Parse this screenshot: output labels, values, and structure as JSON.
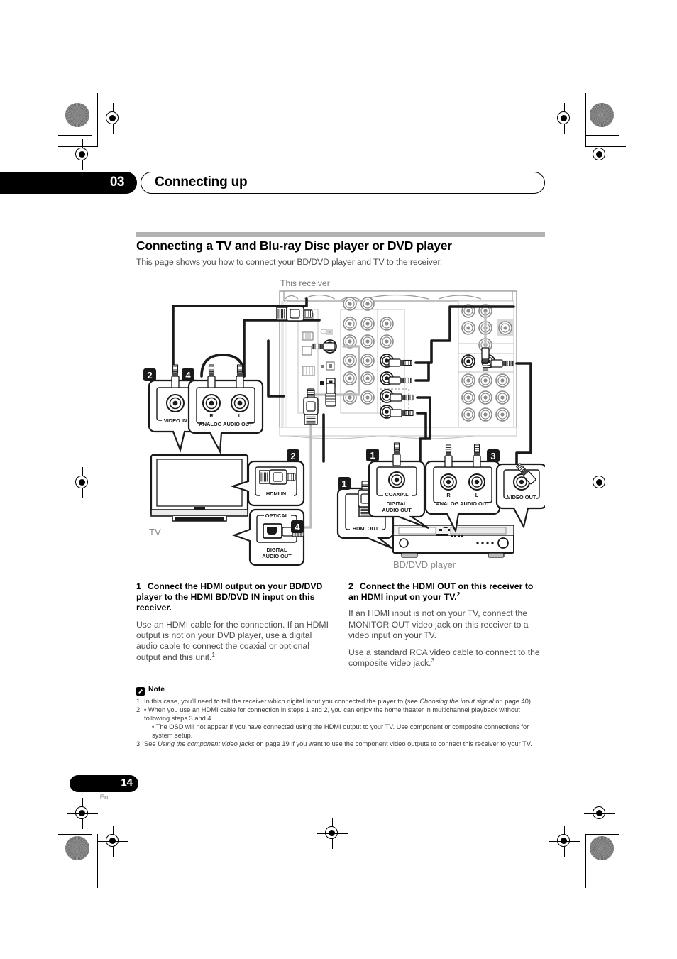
{
  "header": {
    "chapter_number": "03",
    "chapter_title": "Connecting up"
  },
  "section": {
    "title": "Connecting a TV and Blu-ray Disc player or DVD player",
    "subtitle": "This page shows you how to connect your BD/DVD player and TV to the receiver."
  },
  "diagram": {
    "receiver_caption": "This receiver",
    "tv_caption": "TV",
    "player_caption": "BD/DVD player",
    "callouts": {
      "one": "1",
      "two": "2",
      "three": "3",
      "four": "4"
    },
    "ports": {
      "tv_video_in": "VIDEO IN",
      "tv_analog_audio_out": "ANALOG AUDIO OUT",
      "tv_analog_r": "R",
      "tv_analog_l": "L",
      "tv_hdmi_in": "HDMI IN",
      "tv_optical": "OPTICAL",
      "tv_digital_audio_out_line1": "DIGITAL",
      "tv_digital_audio_out_line2": "AUDIO OUT",
      "player_hdmi_out": "HDMI OUT",
      "player_coaxial": "COAXIAL",
      "player_digital_audio_out_line1": "DIGITAL",
      "player_digital_audio_out_line2": "AUDIO OUT",
      "player_analog_audio_out": "ANALOG AUDIO OUT",
      "player_analog_r": "R",
      "player_analog_l": "L",
      "player_video_out": "VIDEO OUT"
    }
  },
  "steps": [
    {
      "number": "1",
      "heading": "Connect the HDMI output on your BD/DVD player to the HDMI BD/DVD IN input on this receiver.",
      "body": "Use an HDMI cable for the connection. If an HDMI output is not on your DVD player, use a digital audio cable to connect the coaxial or optional output and this unit.",
      "body_sup": "1"
    },
    {
      "number": "2",
      "heading": "Connect the HDMI OUT on this receiver to an HDMI input on your TV.",
      "heading_sup": "2",
      "body": "If an HDMI input is not on your TV, connect the MONITOR OUT video jack on this receiver to a video input on your TV.",
      "body2": "Use a standard RCA video cable to connect to the composite video jack.",
      "body2_sup": "3"
    }
  ],
  "note": {
    "title": "Note",
    "items": [
      {
        "num": "1",
        "text_a": "In this case, you'll need to tell the receiver which digital input you connected the player to (see ",
        "italic": "Choosing the input signal",
        "text_b": " on page 40)."
      },
      {
        "num": "2",
        "text_a": "• When you use an HDMI cable for connection in steps 1 and 2, you can enjoy the home theater in multichannel playback without following steps 3 and 4.",
        "sub": "• The OSD will not appear if you have connected using the HDMI output to your TV. Use component or composite connections for system setup."
      },
      {
        "num": "3",
        "text_a": "See ",
        "italic": "Using the component video jacks",
        "text_b": " on page 19 if you want to use the component video outputs to connect this receiver to your TV."
      }
    ]
  },
  "footer": {
    "page_number": "14",
    "language": "En"
  },
  "colors": {
    "rule_gray": "#b2b2b2",
    "body_text": "#4d4d4d",
    "ink": "#000000"
  }
}
